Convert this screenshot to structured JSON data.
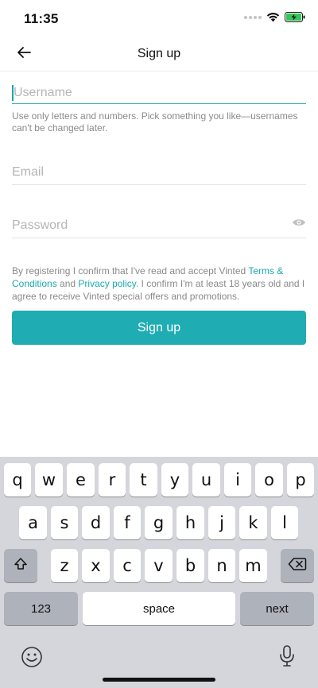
{
  "status_bar": {
    "time": "11:35",
    "icons": [
      "signal-dots",
      "wifi-icon",
      "battery-charging-icon"
    ]
  },
  "nav": {
    "back_icon": "arrow-left-icon",
    "title": "Sign up"
  },
  "form": {
    "username_placeholder": "Username",
    "username_value": "",
    "username_help": "Use only letters and numbers. Pick something you like—usernames can't be changed later.",
    "email_placeholder": "Email",
    "email_value": "",
    "password_placeholder": "Password",
    "password_value": "",
    "password_toggle_icon": "eye-icon",
    "legal_prefix": "By registering I confirm that I've read and accept Vinted ",
    "terms_link": "Terms & Conditions",
    "legal_and": " and ",
    "privacy_link": "Privacy policy",
    "legal_suffix": ". I confirm I'm at least 18 years old and I agree to receive Vinted special offers and promotions.",
    "submit_label": "Sign up"
  },
  "colors": {
    "accent": "#1fadb3",
    "link": "#1aa9ad",
    "keyboard_bg": "#d4d6dc"
  },
  "keyboard": {
    "row1": [
      "q",
      "w",
      "e",
      "r",
      "t",
      "y",
      "u",
      "i",
      "o",
      "p"
    ],
    "row2": [
      "a",
      "s",
      "d",
      "f",
      "g",
      "h",
      "j",
      "k",
      "l"
    ],
    "row3": [
      "z",
      "x",
      "c",
      "v",
      "b",
      "n",
      "m"
    ],
    "numbers_label": "123",
    "space_label": "space",
    "next_label": "next",
    "shift_icon": "shift-icon",
    "delete_icon": "backspace-icon",
    "emoji_icon": "emoji-icon",
    "mic_icon": "microphone-icon"
  }
}
